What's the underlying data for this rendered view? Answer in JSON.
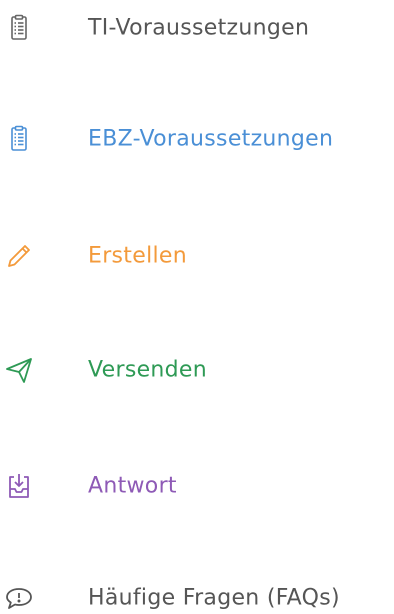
{
  "nav": {
    "items": [
      {
        "label": "TI-Voraussetzungen",
        "icon": "clipboard-icon",
        "color": "#555555"
      },
      {
        "label": "EBZ-Voraussetzungen",
        "icon": "clipboard-icon",
        "color": "#4a8fd6"
      },
      {
        "label": "Erstellen",
        "icon": "pencil-icon",
        "color": "#f39a3b"
      },
      {
        "label": "Versenden",
        "icon": "paper-plane-icon",
        "color": "#2e9a55"
      },
      {
        "label": "Antwort",
        "icon": "inbox-tray-icon",
        "color": "#8e5ab6"
      },
      {
        "label": "Häufige Fragen (FAQs)",
        "icon": "chat-exclamation-icon",
        "color": "#555555"
      }
    ]
  }
}
